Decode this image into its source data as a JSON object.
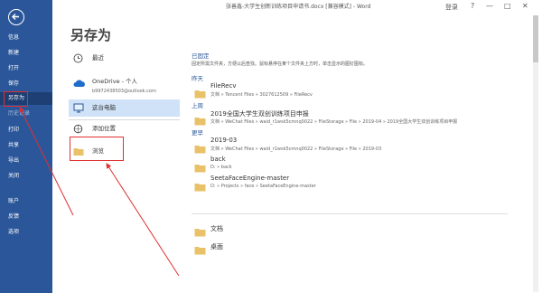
{
  "window": {
    "title": "张善鑫-大学生创新训练项目申请书.docx [兼容模式] - Word",
    "login_label": "登录",
    "help": "?",
    "minimize": "—",
    "restore": "□",
    "close": "✕"
  },
  "nav": {
    "items": [
      "信息",
      "新建",
      "打开",
      "保存",
      "另存为",
      "历史记录",
      "打印",
      "共享",
      "导出",
      "关闭",
      "账户",
      "反馈",
      "选项"
    ]
  },
  "heading": "另存为",
  "locations": {
    "recent": "最近",
    "onedrive_title": "OneDrive - 个人",
    "onedrive_email": "b9972438503@outlook.com",
    "this_pc": "这台电脑",
    "add_location": "添加位置",
    "browse": "浏览"
  },
  "right": {
    "pinned_title": "已固定",
    "pinned_note": "固定所需文件夹，方便以后查找。鼠标悬停在某个文件夹上方时，单击显示的图钉图标。",
    "today": "昨天",
    "last_week": "上周",
    "older": "更早",
    "folders": [
      {
        "name": "FileRecv",
        "path": "文档 » Tencent Files » 3027612509 » FileRecv"
      },
      {
        "name": "2019全国大学生双创训练项目申报",
        "path": "文档 » WeChat Files » waid_r1wsk5cmnq0022 » FileStorage » File » 2019-04 » 2019全国大学生双创训练项目申报"
      },
      {
        "name": "2019-03",
        "path": "文档 » WeChat Files » waid_r1wsk5cmnq0022 » FileStorage » File » 2019-03"
      },
      {
        "name": "back",
        "path": "D: » back"
      },
      {
        "name": "SeetaFaceEngine-master",
        "path": "D: » Projects » face » SeetaFaceEngine-master"
      }
    ],
    "bottom_folders": [
      "文档",
      "桌面"
    ]
  },
  "colors": {
    "accent": "#2b579a",
    "selected_nav": "#1e3f74",
    "annotation": "#e03030",
    "folder": "#e8c169"
  }
}
